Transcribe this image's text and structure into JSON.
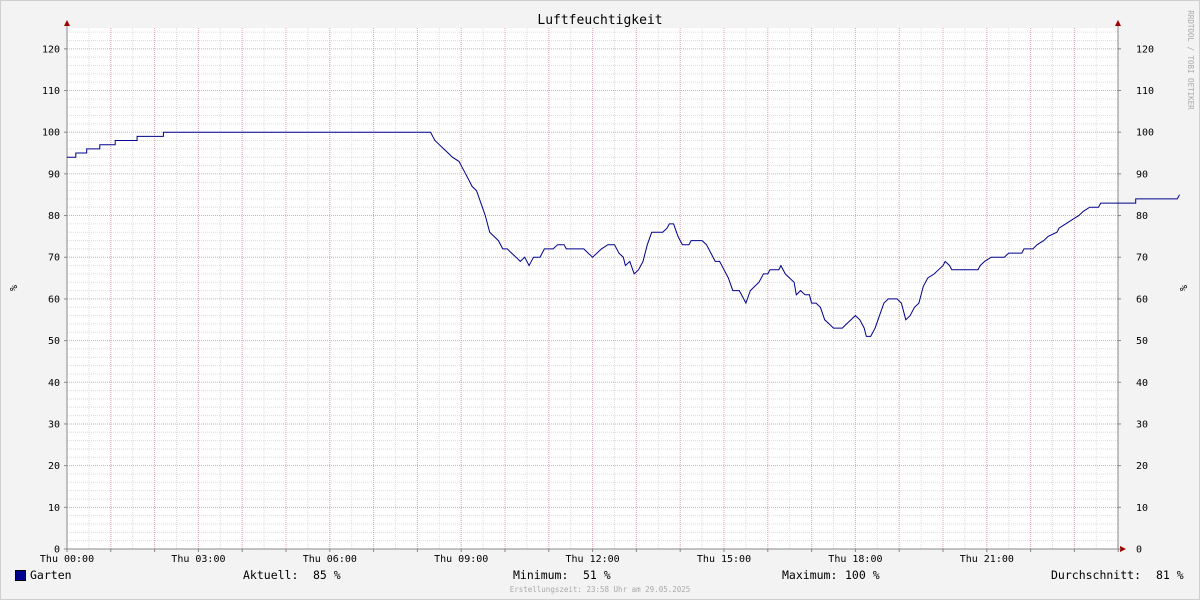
{
  "chart_data": {
    "type": "line",
    "title": "Luftfeuchtigkeit",
    "ylabel": "%",
    "ylabel_right": "%",
    "ylim": [
      0,
      125
    ],
    "yticks": [
      0,
      10,
      20,
      30,
      40,
      50,
      60,
      70,
      80,
      90,
      100,
      110,
      120
    ],
    "xlim": [
      0,
      24
    ],
    "xticks": [
      {
        "x": 0,
        "label": "Thu 00:00"
      },
      {
        "x": 3,
        "label": "Thu 03:00"
      },
      {
        "x": 6,
        "label": "Thu 06:00"
      },
      {
        "x": 9,
        "label": "Thu 09:00"
      },
      {
        "x": 12,
        "label": "Thu 12:00"
      },
      {
        "x": 15,
        "label": "Thu 15:00"
      },
      {
        "x": 18,
        "label": "Thu 18:00"
      },
      {
        "x": 21,
        "label": "Thu 21:00"
      }
    ],
    "grid": true,
    "watermark": "RRDTOOL / TOBI OETIKER",
    "series": [
      {
        "name": "Garten",
        "color": "#00008b",
        "points": [
          [
            0.0,
            94
          ],
          [
            0.2,
            94
          ],
          [
            0.2,
            95
          ],
          [
            0.45,
            95
          ],
          [
            0.45,
            96
          ],
          [
            0.75,
            96
          ],
          [
            0.75,
            97
          ],
          [
            1.1,
            97
          ],
          [
            1.1,
            98
          ],
          [
            1.6,
            98
          ],
          [
            1.6,
            99
          ],
          [
            2.2,
            99
          ],
          [
            2.2,
            100
          ],
          [
            8.3,
            100
          ],
          [
            8.4,
            98
          ],
          [
            8.5,
            97
          ],
          [
            8.6,
            96
          ],
          [
            8.7,
            95
          ],
          [
            8.8,
            94
          ],
          [
            8.95,
            93
          ],
          [
            9.05,
            91
          ],
          [
            9.15,
            89
          ],
          [
            9.25,
            87
          ],
          [
            9.35,
            86
          ],
          [
            9.45,
            83
          ],
          [
            9.55,
            80
          ],
          [
            9.65,
            76
          ],
          [
            9.75,
            75
          ],
          [
            9.85,
            74
          ],
          [
            9.95,
            72
          ],
          [
            10.05,
            72
          ],
          [
            10.15,
            71
          ],
          [
            10.25,
            70
          ],
          [
            10.35,
            69
          ],
          [
            10.45,
            70
          ],
          [
            10.55,
            68
          ],
          [
            10.65,
            70
          ],
          [
            10.8,
            70
          ],
          [
            10.9,
            72
          ],
          [
            11.1,
            72
          ],
          [
            11.2,
            73
          ],
          [
            11.35,
            73
          ],
          [
            11.4,
            72
          ],
          [
            11.8,
            72
          ],
          [
            11.9,
            71
          ],
          [
            12.0,
            70
          ],
          [
            12.1,
            71
          ],
          [
            12.2,
            72
          ],
          [
            12.35,
            73
          ],
          [
            12.5,
            73
          ],
          [
            12.6,
            71
          ],
          [
            12.7,
            70
          ],
          [
            12.75,
            68
          ],
          [
            12.85,
            69
          ],
          [
            12.95,
            66
          ],
          [
            13.05,
            67
          ],
          [
            13.15,
            69
          ],
          [
            13.25,
            73
          ],
          [
            13.35,
            76
          ],
          [
            13.6,
            76
          ],
          [
            13.7,
            77
          ],
          [
            13.75,
            78
          ],
          [
            13.85,
            78
          ],
          [
            13.95,
            75
          ],
          [
            14.05,
            73
          ],
          [
            14.2,
            73
          ],
          [
            14.25,
            74
          ],
          [
            14.5,
            74
          ],
          [
            14.6,
            73
          ],
          [
            14.7,
            71
          ],
          [
            14.8,
            69
          ],
          [
            14.9,
            69
          ],
          [
            15.0,
            67
          ],
          [
            15.1,
            65
          ],
          [
            15.2,
            62
          ],
          [
            15.35,
            62
          ],
          [
            15.45,
            60
          ],
          [
            15.5,
            59
          ],
          [
            15.6,
            62
          ],
          [
            15.7,
            63
          ],
          [
            15.8,
            64
          ],
          [
            15.9,
            66
          ],
          [
            16.0,
            66
          ],
          [
            16.05,
            67
          ],
          [
            16.25,
            67
          ],
          [
            16.3,
            68
          ],
          [
            16.4,
            66
          ],
          [
            16.5,
            65
          ],
          [
            16.6,
            64
          ],
          [
            16.65,
            61
          ],
          [
            16.75,
            62
          ],
          [
            16.85,
            61
          ],
          [
            16.95,
            61
          ],
          [
            17.0,
            59
          ],
          [
            17.1,
            59
          ],
          [
            17.2,
            58
          ],
          [
            17.3,
            55
          ],
          [
            17.4,
            54
          ],
          [
            17.5,
            53
          ],
          [
            17.7,
            53
          ],
          [
            17.8,
            54
          ],
          [
            17.9,
            55
          ],
          [
            18.0,
            56
          ],
          [
            18.1,
            55
          ],
          [
            18.2,
            53
          ],
          [
            18.25,
            51
          ],
          [
            18.35,
            51
          ],
          [
            18.45,
            53
          ],
          [
            18.55,
            56
          ],
          [
            18.65,
            59
          ],
          [
            18.75,
            60
          ],
          [
            18.95,
            60
          ],
          [
            19.05,
            59
          ],
          [
            19.15,
            55
          ],
          [
            19.25,
            56
          ],
          [
            19.35,
            58
          ],
          [
            19.45,
            59
          ],
          [
            19.55,
            63
          ],
          [
            19.65,
            65
          ],
          [
            19.8,
            66
          ],
          [
            19.9,
            67
          ],
          [
            20.0,
            68
          ],
          [
            20.05,
            69
          ],
          [
            20.15,
            68
          ],
          [
            20.2,
            67
          ],
          [
            20.8,
            67
          ],
          [
            20.85,
            68
          ],
          [
            20.95,
            69
          ],
          [
            21.1,
            70
          ],
          [
            21.4,
            70
          ],
          [
            21.5,
            71
          ],
          [
            21.8,
            71
          ],
          [
            21.85,
            72
          ],
          [
            22.05,
            72
          ],
          [
            22.15,
            73
          ],
          [
            22.3,
            74
          ],
          [
            22.4,
            75
          ],
          [
            22.6,
            76
          ],
          [
            22.65,
            77
          ],
          [
            22.8,
            78
          ],
          [
            22.95,
            79
          ],
          [
            23.1,
            80
          ],
          [
            23.2,
            81
          ],
          [
            23.35,
            82
          ],
          [
            23.55,
            82
          ],
          [
            23.6,
            83
          ],
          [
            24.4,
            83
          ],
          [
            24.4,
            84
          ],
          [
            25.35,
            84
          ],
          [
            25.4,
            85
          ]
        ]
      }
    ]
  },
  "legend": {
    "series_label": "Garten",
    "current_label": "Aktuell:",
    "current_value": "85 %",
    "min_label": "Minimum:",
    "min_value": "51 %",
    "max_label": "Maximum:",
    "max_value": "100 %",
    "avg_label": "Durchschnitt:",
    "avg_value": "81 %"
  },
  "footer": "Erstellungszeit: 23:58 Uhr am 29.05.2025"
}
